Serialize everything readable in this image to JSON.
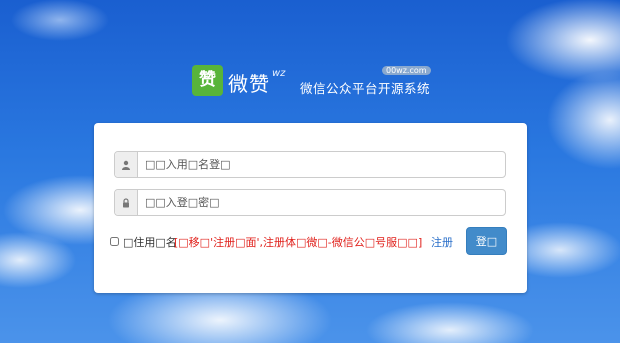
{
  "brand": {
    "badge_char": "赞",
    "name": "微赞",
    "name_suffix": "wz",
    "domain_tag": "00wz.com",
    "slogan": "微信公众平台开源系统"
  },
  "login_form": {
    "username_placeholder": "□□入用□名登□",
    "password_placeholder": "□□入登□密□",
    "remember_label": "□住用□名",
    "notice_text": "[□移□'注册□面',注册体□微□-微信公□号服□□]",
    "register_link": "注册",
    "login_button": "登□",
    "icons": {
      "username": "user-icon",
      "password": "lock-icon"
    }
  },
  "colors": {
    "sky": "#2a78e0",
    "login_button": "#428bca",
    "notice": "#e0201b",
    "link": "#2a6fc9",
    "logo_badge": "#58b43a"
  }
}
